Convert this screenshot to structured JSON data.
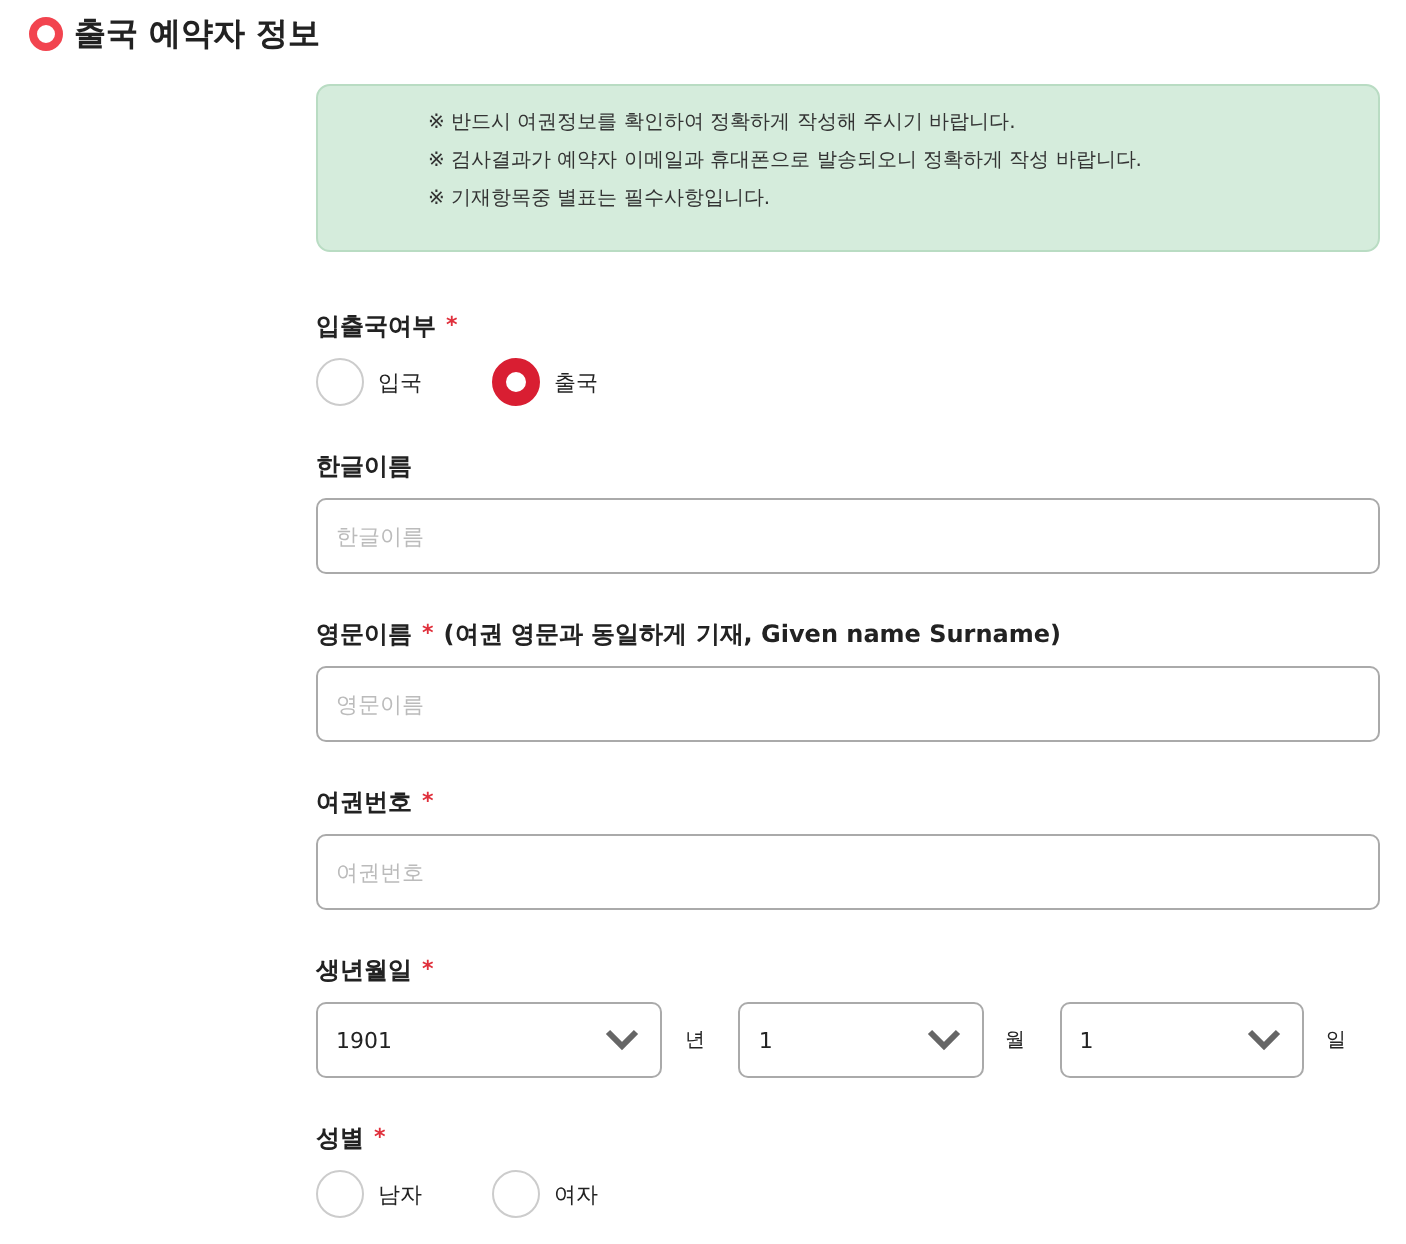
{
  "title": "출국 예약자 정보",
  "notice": [
    "※ 반드시 여권정보를 확인하여 정확하게 작성해 주시기 바랍니다.",
    "※ 검사결과가 예약자 이메일과 휴대폰으로 발송되오니 정확하게 작성 바랍니다.",
    "※ 기재항목중 별표는 필수사항입니다."
  ],
  "fields": [
    {
      "kind": "radio",
      "label": "입출국여부",
      "required_mark": "*",
      "options": [
        {
          "label": "입국",
          "selected": false
        },
        {
          "label": "출국",
          "selected": true
        }
      ]
    },
    {
      "kind": "text",
      "label": "한글이름",
      "placeholder": "한글이름"
    },
    {
      "kind": "text",
      "label": "영문이름",
      "required_mark": "*",
      "note": "(여권 영문과 동일하게 기재, Given name Surname)",
      "placeholder": "영문이름"
    },
    {
      "kind": "text",
      "label": "여권번호",
      "required_mark": "*",
      "placeholder": "여권번호"
    },
    {
      "kind": "date",
      "label": "생년월일",
      "required_mark": "*",
      "selects": [
        {
          "value": "1901",
          "unit": "년"
        },
        {
          "value": "1",
          "unit": "월"
        },
        {
          "value": "1",
          "unit": "일"
        }
      ]
    },
    {
      "kind": "radio",
      "label": "성별",
      "required_mark": "*",
      "options": [
        {
          "label": "남자",
          "selected": false
        },
        {
          "label": "여자",
          "selected": false
        }
      ]
    }
  ]
}
